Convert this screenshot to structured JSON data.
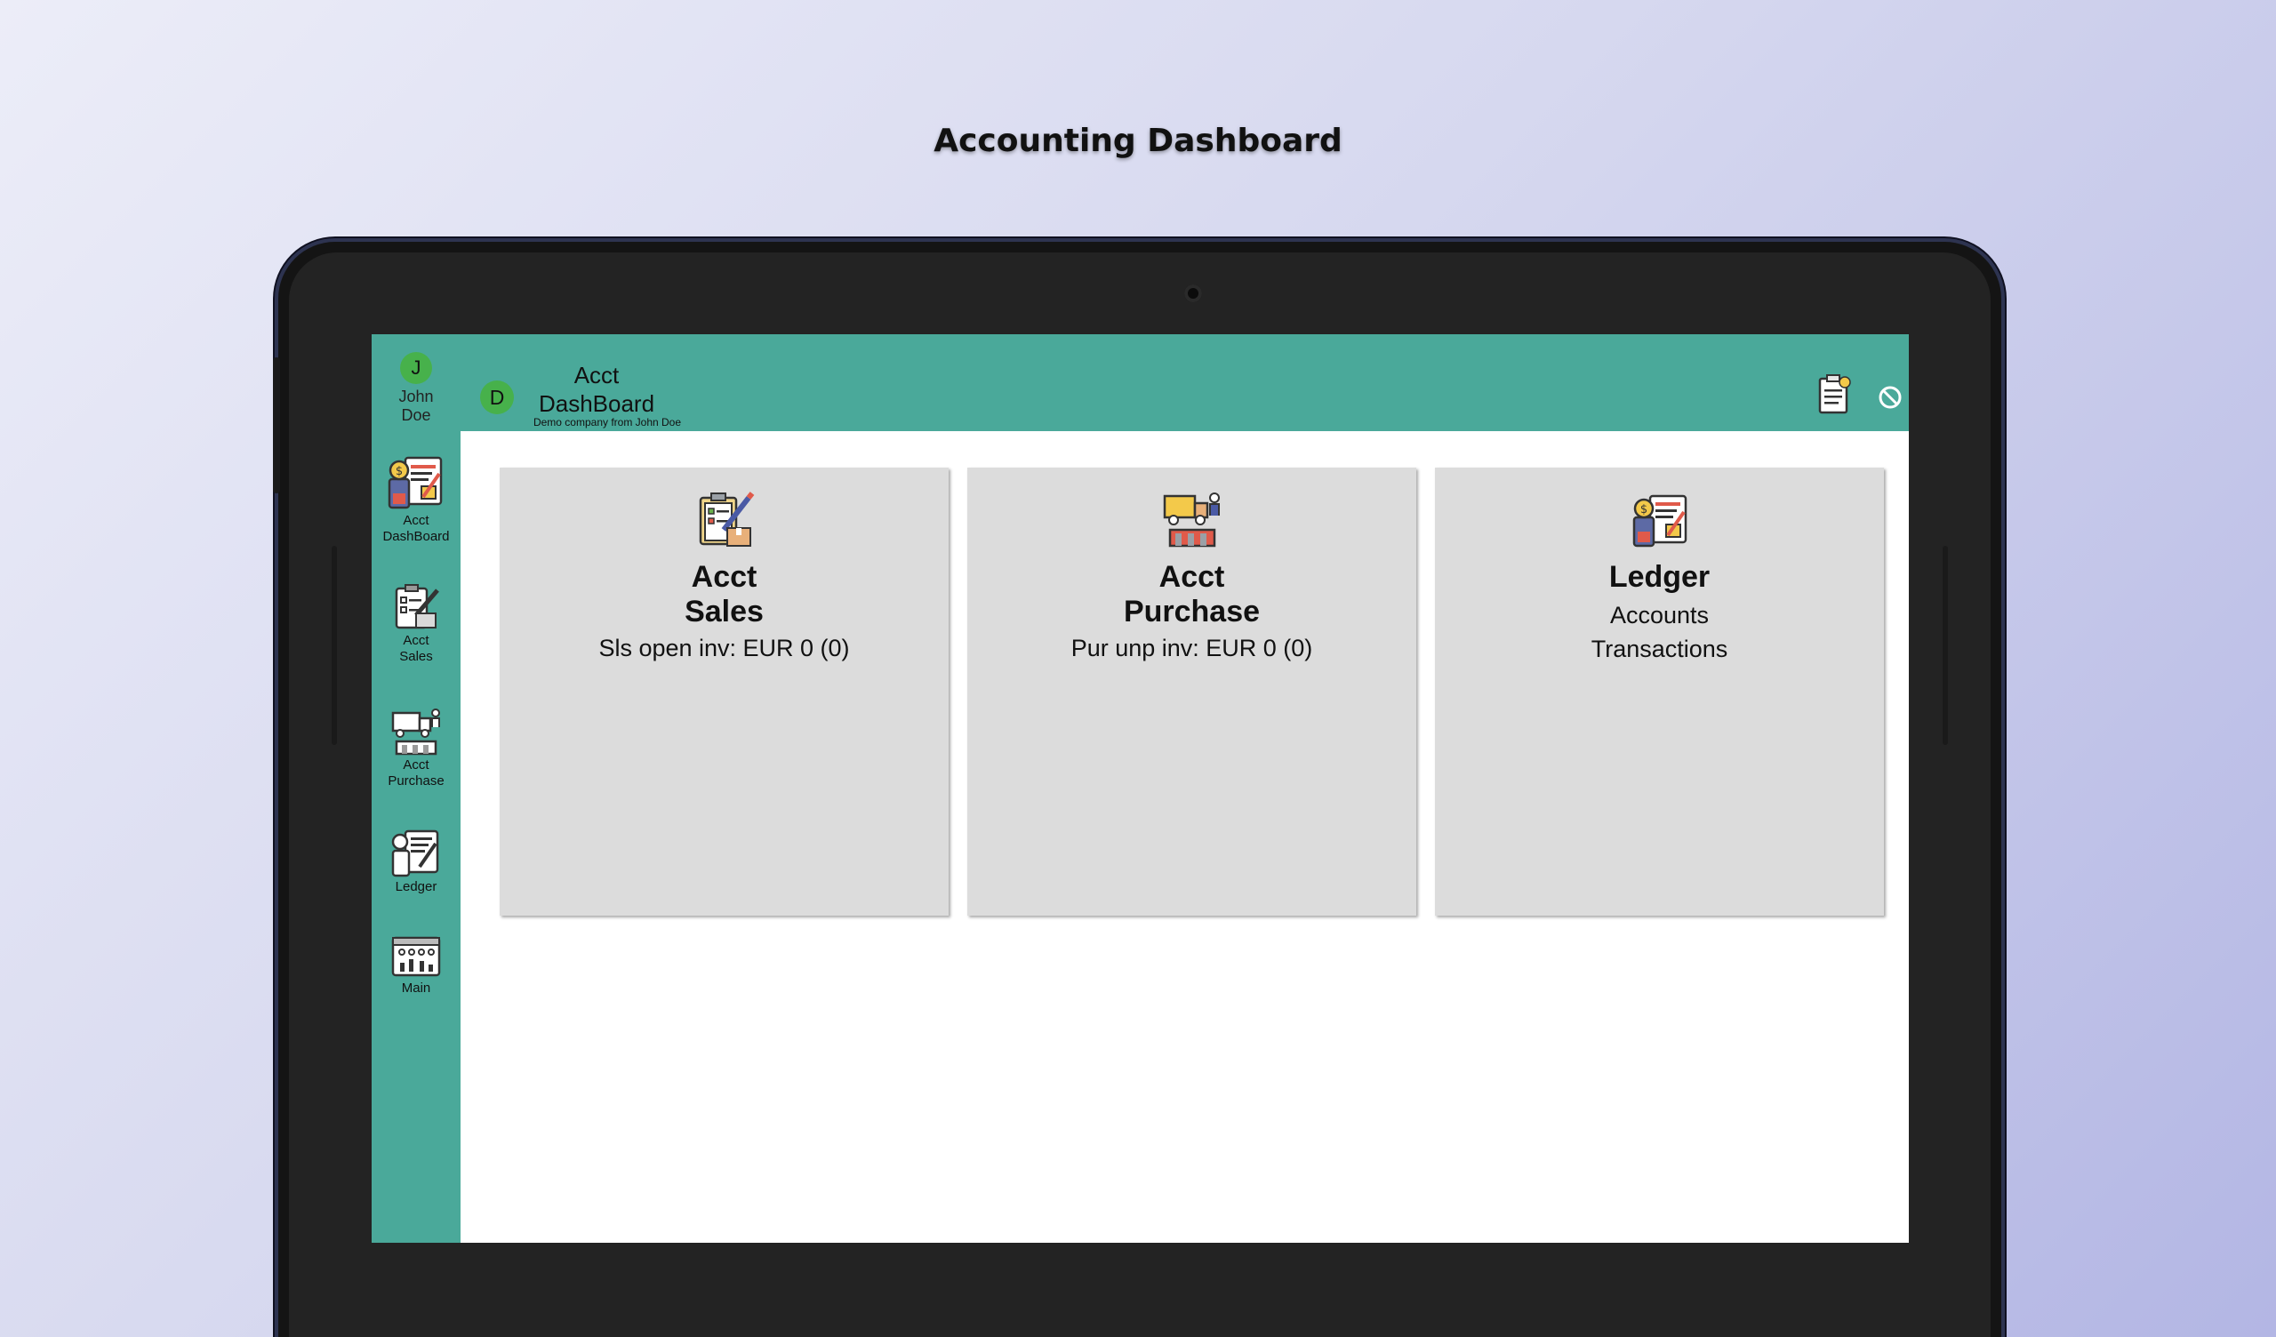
{
  "page": {
    "title": "Accounting Dashboard"
  },
  "user": {
    "initial": "J",
    "first_name": "John",
    "last_name": "Doe"
  },
  "sidebar": {
    "items": [
      {
        "label_line1": "Acct",
        "label_line2": "DashBoard",
        "icon": "ledger-calculator-icon"
      },
      {
        "label_line1": "Acct",
        "label_line2": "Sales",
        "icon": "sales-clipboard-icon"
      },
      {
        "label_line1": "Acct",
        "label_line2": "Purchase",
        "icon": "purchase-truck-icon"
      },
      {
        "label_line1": "Ledger",
        "label_line2": "",
        "icon": "ledger-icon"
      },
      {
        "label_line1": "Main",
        "label_line2": "",
        "icon": "main-dashboard-icon"
      }
    ]
  },
  "header": {
    "company_initial": "D",
    "title_line1": "Acct",
    "title_line2": "DashBoard",
    "subtitle": "Demo company from John Doe",
    "actions": {
      "notes_icon": "notes-icon",
      "block_icon": "block-icon"
    }
  },
  "cards": [
    {
      "title_line1": "Acct",
      "title_line2": "Sales",
      "line1": "Sls open inv: EUR 0 (0)",
      "line2": "",
      "icon": "sales-clipboard-icon"
    },
    {
      "title_line1": "Acct",
      "title_line2": "Purchase",
      "line1": "Pur unp inv: EUR 0 (0)",
      "line2": "",
      "icon": "purchase-truck-icon"
    },
    {
      "title_line1": "Ledger",
      "title_line2": "",
      "line1": "Accounts",
      "line2": "Transactions",
      "icon": "ledger-calculator-icon"
    }
  ],
  "colors": {
    "teal": "#4aa99a",
    "avatar_green": "#47b14b",
    "card_gray": "#dcdcdc",
    "tablet_frame": "#141414"
  }
}
